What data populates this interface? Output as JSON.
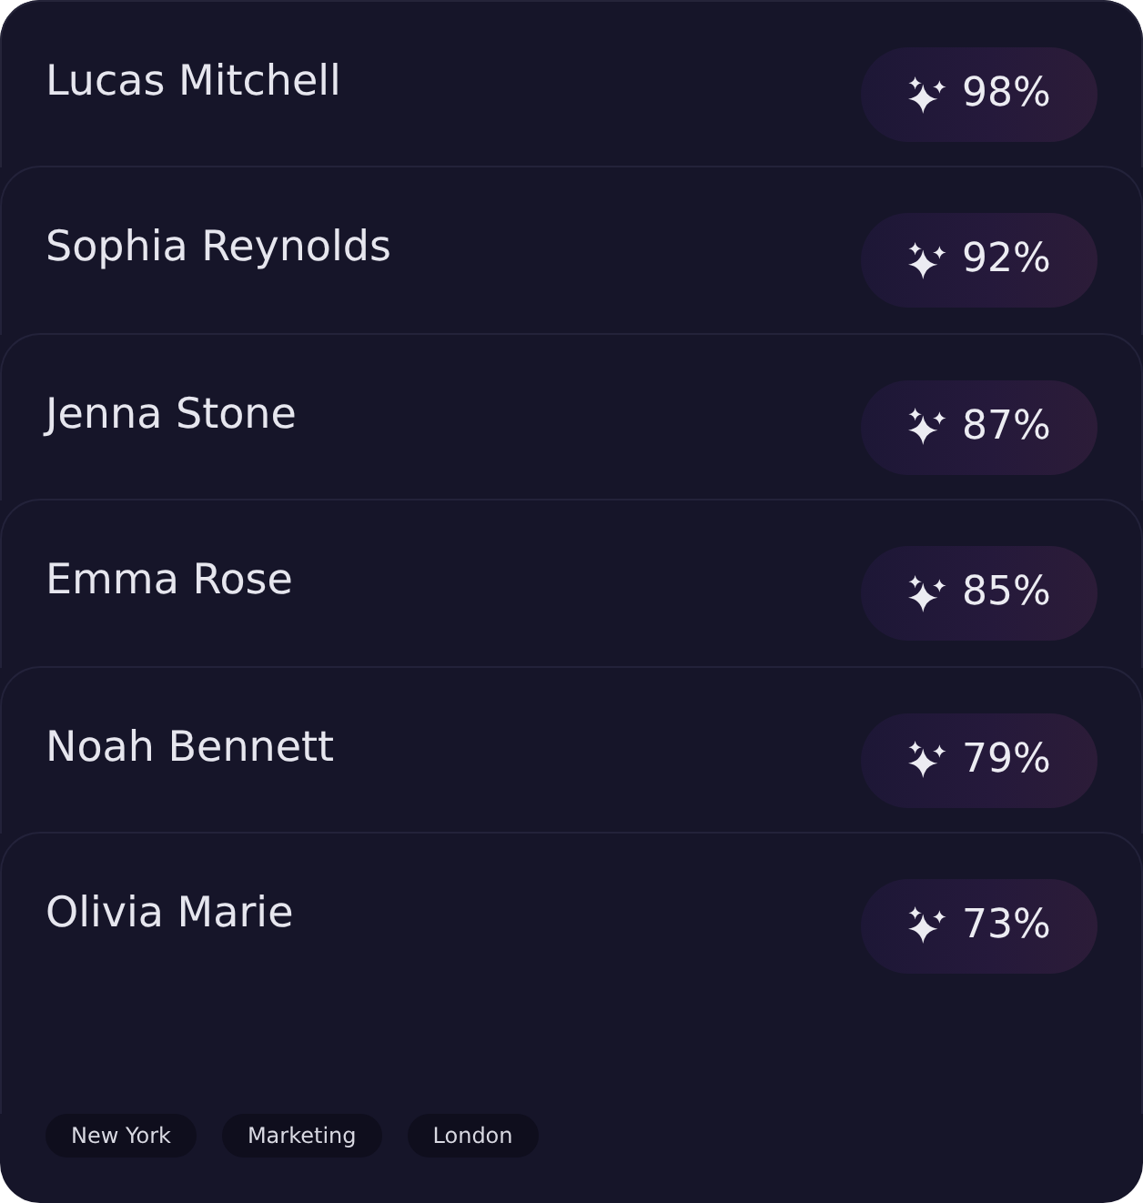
{
  "candidates": [
    {
      "name": "Lucas Mitchell",
      "score": "98%"
    },
    {
      "name": "Sophia Reynolds",
      "score": "92%"
    },
    {
      "name": "Jenna Stone",
      "score": "87%"
    },
    {
      "name": "Emma Rose",
      "score": "85%"
    },
    {
      "name": "Noah Bennett",
      "score": "79%"
    },
    {
      "name": "Olivia Marie",
      "score": "73%"
    }
  ],
  "tags": [
    "New York",
    "Marketing",
    "London"
  ]
}
